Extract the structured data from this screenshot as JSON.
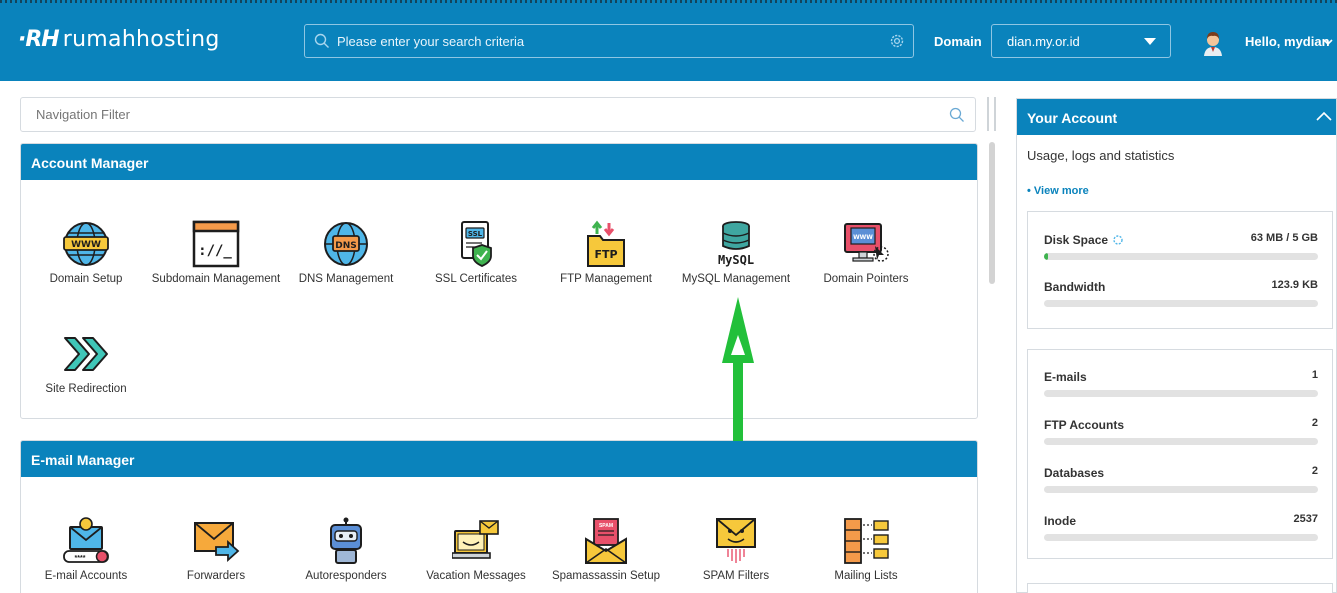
{
  "header": {
    "logo_mark": "·RH",
    "logo_text": "rumahhosting",
    "search_placeholder": "Please enter your search criteria",
    "domain_label": "Domain",
    "domain_value": "dian.my.or.id",
    "greeting": "Hello, mydian",
    "brand_color": "#0a83bc"
  },
  "nav_filter": {
    "placeholder": "Navigation Filter"
  },
  "account_manager": {
    "title": "Account Manager",
    "items": [
      {
        "label": "Domain Setup",
        "icon": "globe-www-icon"
      },
      {
        "label": "Subdomain Management",
        "icon": "terminal-window-icon"
      },
      {
        "label": "DNS Management",
        "icon": "dns-globe-icon"
      },
      {
        "label": "SSL Certificates",
        "icon": "ssl-certificate-icon"
      },
      {
        "label": "FTP Management",
        "icon": "ftp-folder-icon"
      },
      {
        "label": "MySQL Management",
        "icon": "mysql-database-icon"
      },
      {
        "label": "Domain Pointers",
        "icon": "domain-pointer-icon"
      },
      {
        "label": "Site Redirection",
        "icon": "redirect-arrows-icon"
      }
    ]
  },
  "email_manager": {
    "title": "E-mail Manager",
    "items": [
      {
        "label": "E-mail Accounts",
        "icon": "email-account-icon"
      },
      {
        "label": "Forwarders",
        "icon": "forward-envelope-icon"
      },
      {
        "label": "Autoresponders",
        "icon": "robot-icon"
      },
      {
        "label": "Vacation Messages",
        "icon": "vacation-laptop-icon"
      },
      {
        "label": "Spamassassin Setup",
        "icon": "spam-envelope-icon"
      },
      {
        "label": "SPAM Filters",
        "icon": "spam-filter-icon"
      },
      {
        "label": "Mailing Lists",
        "icon": "mailing-list-icon"
      }
    ]
  },
  "your_account": {
    "title": "Your Account",
    "subtitle": "Usage, logs and statistics",
    "view_more": "• View more",
    "disk_space": {
      "label": "Disk Space",
      "value": "63 MB / 5 GB",
      "fraction": 0.0126
    },
    "bandwidth": {
      "label": "Bandwidth",
      "value": "123.9 KB",
      "fraction": 0
    },
    "counts": [
      {
        "label": "E-mails",
        "value": "1"
      },
      {
        "label": "FTP Accounts",
        "value": "2"
      },
      {
        "label": "Databases",
        "value": "2"
      },
      {
        "label": "Inode",
        "value": "2537"
      }
    ],
    "progress_fill_color": "#3fb34f"
  },
  "annotation": {
    "arrow_color": "#22c03a"
  }
}
